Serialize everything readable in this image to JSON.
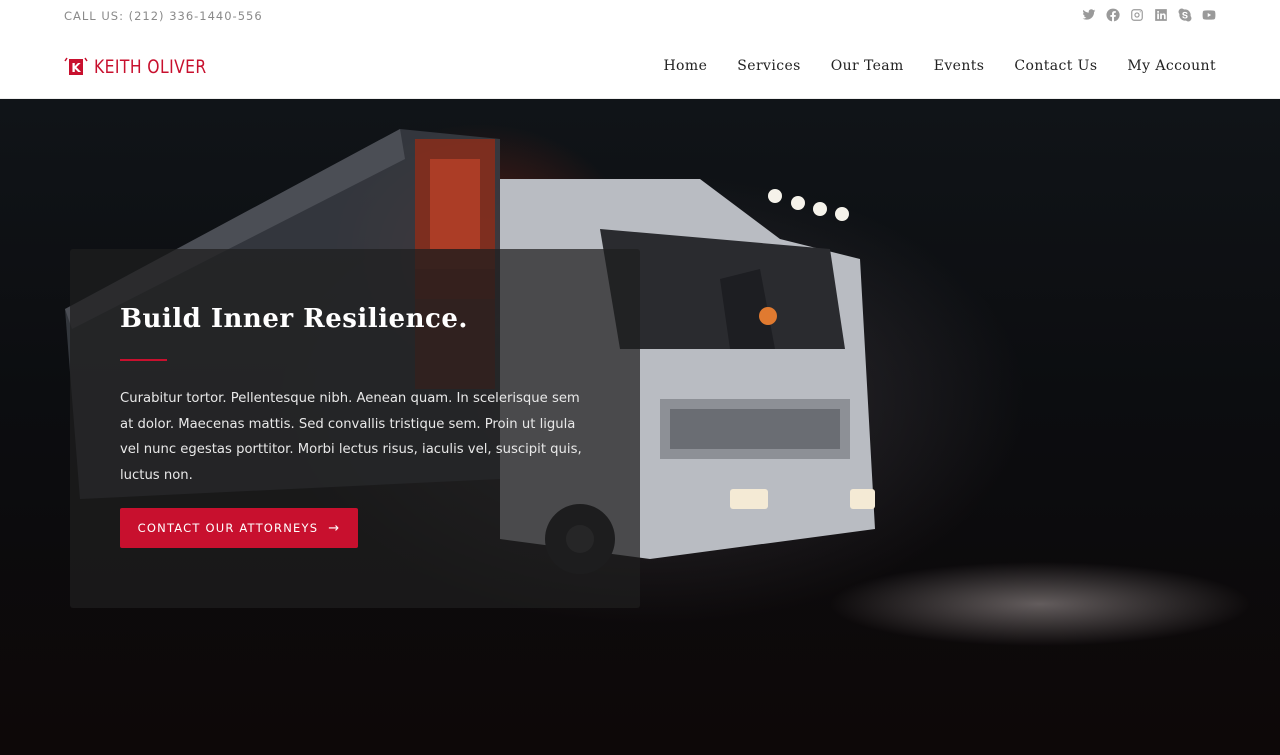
{
  "topbar": {
    "phone": "CALL US: (212) 336-1440-556",
    "social": [
      "twitter-icon",
      "facebook-icon",
      "instagram-icon",
      "linkedin-icon",
      "skype-icon",
      "youtube-icon"
    ]
  },
  "header": {
    "logo_text": "KEITH OLIVER",
    "logo_mark": "K",
    "nav": [
      "Home",
      "Services",
      "Our Team",
      "Events",
      "Contact Us",
      "My Account"
    ]
  },
  "hero": {
    "title": "Build Inner Resilience.",
    "body": "Curabitur tortor. Pellentesque nibh. Aenean quam. In scelerisque sem at dolor. Maecenas mattis. Sed convallis tristique sem. Proin ut ligula vel nunc egestas porttitor. Morbi lectus risus, iaculis vel, suscipit quis, luctus non.",
    "cta_label": "CONTACT OUR ATTORNEYS",
    "cta_arrow": "→"
  },
  "colors": {
    "accent": "#c8102e",
    "nav_text": "#222222",
    "topbar_text": "#8a8a8a"
  }
}
